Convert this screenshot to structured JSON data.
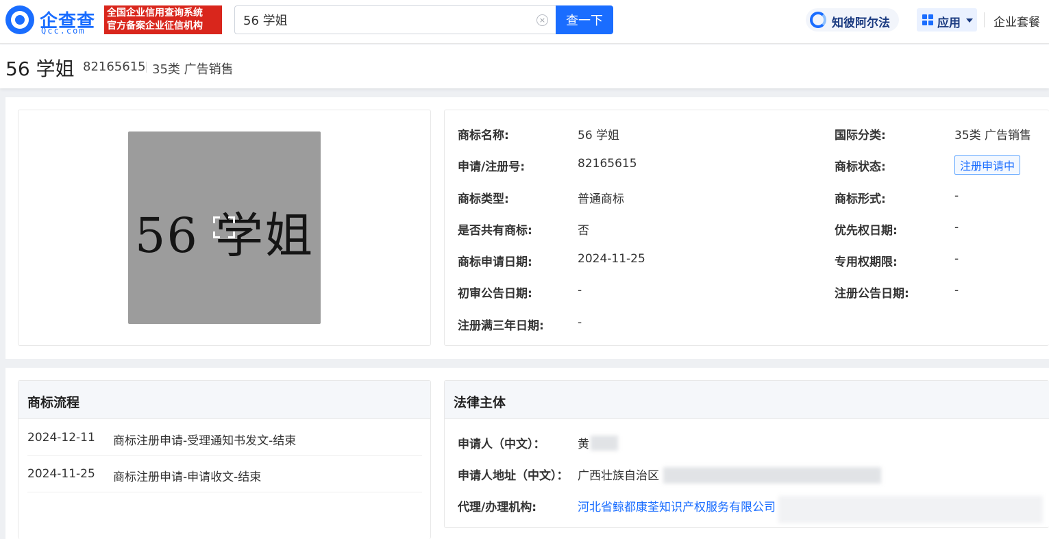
{
  "header": {
    "logo_text": "企查查",
    "logo_sub": "Qcc.com",
    "badge_line1": "全国企业信用查询系统",
    "badge_line2": "官方备案企业征信机构",
    "search_value": "56 学姐",
    "clear_icon": "×",
    "search_button": "查一下",
    "zhibi_label": "知彼阿尔法",
    "apps_label": "应用",
    "suite_label": "企业套餐"
  },
  "title": {
    "name": "56 学姐",
    "number": "82165615",
    "class": "35类 广告销售"
  },
  "trademark_image": {
    "text": "56 学姐",
    "icon": "expand-icon"
  },
  "info": {
    "left": [
      {
        "label": "商标名称:",
        "value": "56 学姐"
      },
      {
        "label": "申请/注册号:",
        "value": "82165615"
      },
      {
        "label": "商标类型:",
        "value": "普通商标"
      },
      {
        "label": "是否共有商标:",
        "value": "否"
      },
      {
        "label": "商标申请日期:",
        "value": "2024-11-25"
      },
      {
        "label": "初审公告日期:",
        "value": "-"
      },
      {
        "label": "注册满三年日期:",
        "value": "-"
      }
    ],
    "right": [
      {
        "label": "国际分类:",
        "value": "35类 广告销售"
      },
      {
        "label": "商标状态:",
        "value": "注册申请中"
      },
      {
        "label": "商标形式:",
        "value": "-"
      },
      {
        "label": "优先权日期:",
        "value": "-"
      },
      {
        "label": "专用权期限:",
        "value": "-"
      },
      {
        "label": "注册公告日期:",
        "value": "-"
      }
    ]
  },
  "flow": {
    "title": "商标流程",
    "items": [
      {
        "date": "2024-12-11",
        "desc": "商标注册申请-受理通知书发文-结束"
      },
      {
        "date": "2024-11-25",
        "desc": "商标注册申请-申请收文-结束"
      }
    ]
  },
  "legal": {
    "title": "法律主体",
    "rows": [
      {
        "label": "申请人（中文）：",
        "value": "黄"
      },
      {
        "label": "申请人地址（中文）：",
        "value": "广西壮族自治区"
      },
      {
        "label": "代理/办理机构:",
        "value": "河北省鲸都康荃知识产权服务有限公司"
      }
    ]
  },
  "colors": {
    "brand": "#1a6dff",
    "badge": "#d9261c"
  }
}
